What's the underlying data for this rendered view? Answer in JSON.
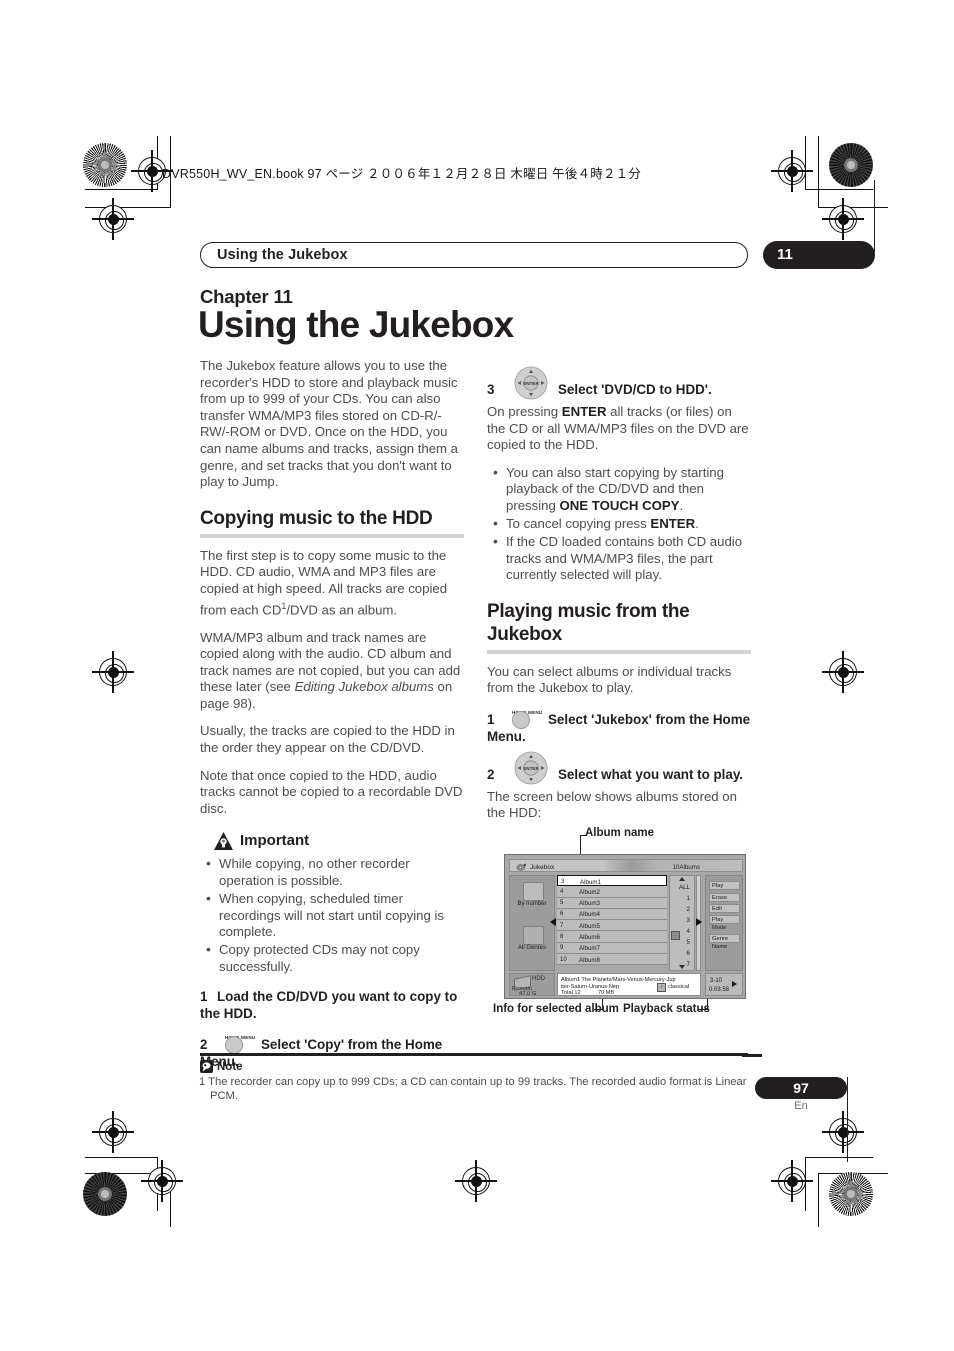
{
  "print_header": {
    "text": "DVR550H_WV_EN.book  97 ページ  ２００６年１２月２８日   木曜日   午後４時２１分"
  },
  "running_head": {
    "title": "Using the Jukebox",
    "chapter_number": "11"
  },
  "heading": {
    "chapter_label": "Chapter 11",
    "chapter_title": "Using the Jukebox"
  },
  "left_column": {
    "intro": "The Jukebox feature allows you to use the recorder's HDD to store and playback music from up to 999 of your CDs. You can also transfer WMA/MP3 files stored on CD-R/-RW/-ROM or DVD. Once on the HDD, you can name albums and tracks, assign them a genre, and set tracks that you don't want to play to Jump.",
    "section_title": "Copying music to the HDD",
    "para1_a": "The first step is to copy some music to the HDD. CD audio, WMA and MP3 files are copied at high speed. All tracks are copied from each CD",
    "para1_sup": "1",
    "para1_b": "/DVD as an album.",
    "para2_a": "WMA/MP3 album and track names are copied along with the audio. CD album and track names are not copied, but you can add these later (see ",
    "para2_italic": "Editing Jukebox albums",
    "para2_b": " on page 98).",
    "para3": "Usually, the tracks are copied to the HDD in the order they appear on the CD/DVD.",
    "para4": "Note that once copied to the HDD, audio tracks cannot be copied to a recordable DVD disc.",
    "important_label": "Important",
    "important_bullets": [
      "While copying, no other recorder operation is possible.",
      "When copying, scheduled timer recordings will not start until copying is complete.",
      "Copy protected CDs may not copy successfully."
    ],
    "step1_num": "1",
    "step1_text": "Load the CD/DVD you want to copy to the HDD.",
    "step2_num": "2",
    "step2_key": "HOME MENU",
    "step2_text": "Select 'Copy' from the Home Menu."
  },
  "right_column": {
    "step3_num": "3",
    "step3_key": "ENTER",
    "step3_text": "Select 'DVD/CD to HDD'.",
    "step3_body_a": "On pressing ",
    "step3_body_bold": "ENTER",
    "step3_body_b": " all tracks (or files) on the CD or all WMA/MP3 files on the DVD are copied to the HDD.",
    "bullet1_a": "You can also start copying by starting playback of the CD/DVD and then pressing ",
    "bullet1_bold": "ONE TOUCH COPY",
    "bullet1_b": ".",
    "bullet2_a": "To cancel copying press ",
    "bullet2_bold": "ENTER",
    "bullet2_b": ".",
    "bullet3": "If the CD loaded contains both CD audio tracks and WMA/MP3 files, the part currently selected will play.",
    "section_title": "Playing music from the Jukebox",
    "para1": "You can select albums or individual tracks from the Jukebox to play.",
    "step1_num": "1",
    "step1_key": "HOME MENU",
    "step1_text": "Select 'Jukebox' from the Home Menu.",
    "step2_num": "2",
    "step2_key": "ENTER",
    "step2_text": "Select what you want to play.",
    "step2_body": "The screen below shows albums stored on the HDD:"
  },
  "figure": {
    "callout_album_name": "Album name",
    "callout_info": "Info for selected album",
    "callout_playback": "Playback status",
    "screen": {
      "title": "Jukebox",
      "album_count": "10Albums",
      "left_panel": {
        "sort_label": "By number",
        "genre_label": "All Genres",
        "hdd_label": "HDD",
        "remain_label": "Remain",
        "remain_value": "47.0 G"
      },
      "list": [
        {
          "n": "3",
          "t": "Album1"
        },
        {
          "n": "4",
          "t": "Album2"
        },
        {
          "n": "5",
          "t": "Album3"
        },
        {
          "n": "6",
          "t": "Album4"
        },
        {
          "n": "7",
          "t": "Album5"
        },
        {
          "n": "8",
          "t": "Album6"
        },
        {
          "n": "9",
          "t": "Album7"
        },
        {
          "n": "10",
          "t": "Album8"
        }
      ],
      "scroll_items": [
        "ALL",
        "1",
        "2",
        "3",
        "4",
        "5",
        "6",
        "7"
      ],
      "menu_buttons": [
        "Play",
        "Erase",
        "Edit",
        "Play Mode"
      ],
      "genre_button": "Genre Name",
      "info": {
        "line1": "Album1   The Planets/Mars-Venus-Mercury-Jup",
        "line2": "iter-Saturn-Uranus-Nep",
        "line3_a": "Total 12",
        "line3_b": "70 MB",
        "genre": "classical"
      },
      "playback": {
        "track": "3-10",
        "time": "0.03.58"
      }
    }
  },
  "note": {
    "label": "Note",
    "index": "1",
    "text": "The recorder can copy up to 999 CDs; a CD can contain up to 99 tracks. The recorded audio format is Linear",
    "text_cont": "PCM."
  },
  "footer": {
    "page_number": "97",
    "language": "En"
  },
  "colors": {
    "ink": "#231f20",
    "body": "#4d4d4d",
    "rule": "#d3d3d3",
    "screen_bg": "#a8a8a8"
  }
}
